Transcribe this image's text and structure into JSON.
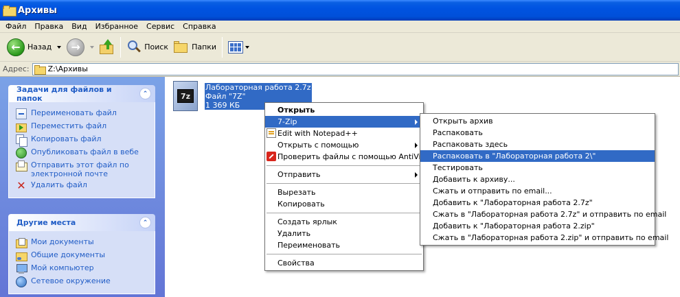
{
  "window": {
    "title": "Архивы"
  },
  "menubar": {
    "items": [
      "Файл",
      "Правка",
      "Вид",
      "Избранное",
      "Сервис",
      "Справка"
    ]
  },
  "toolbar": {
    "back_label": "Назад",
    "search_label": "Поиск",
    "folders_label": "Папки"
  },
  "address": {
    "label": "Адрес:",
    "value": "Z:\\Архивы"
  },
  "tasks_panel": {
    "title": "Задачи для файлов и папок",
    "items": [
      {
        "label": "Переименовать файл",
        "icon": "rename-icon"
      },
      {
        "label": "Переместить файл",
        "icon": "move-icon"
      },
      {
        "label": "Копировать файл",
        "icon": "copy-icon"
      },
      {
        "label": "Опубликовать файл в вебе",
        "icon": "web-publish-icon"
      },
      {
        "label": "Отправить этот файл по электронной почте",
        "icon": "email-icon"
      },
      {
        "label": "Удалить файл",
        "icon": "delete-icon"
      }
    ]
  },
  "places_panel": {
    "title": "Другие места",
    "items": [
      {
        "label": "Мои документы",
        "icon": "my-documents-icon"
      },
      {
        "label": "Общие документы",
        "icon": "shared-documents-icon"
      },
      {
        "label": "Мой компьютер",
        "icon": "my-computer-icon"
      },
      {
        "label": "Сетевое окружение",
        "icon": "network-icon"
      }
    ]
  },
  "file": {
    "name": "Лабораторная работа 2.7z",
    "type": "Файл \"7Z\"",
    "size": "1 369 КБ",
    "badge": "7z"
  },
  "context_menu": {
    "open": "Открыть",
    "sevenzip": "7-Zip",
    "notepad": "Edit with Notepad++",
    "open_with": "Открыть с помощью",
    "antivir": "Проверить файлы с помощью AntiVir",
    "send_to": "Отправить",
    "cut": "Вырезать",
    "copy": "Копировать",
    "shortcut": "Создать ярлык",
    "delete": "Удалить",
    "rename": "Переименовать",
    "properties": "Свойства"
  },
  "submenu_7zip": {
    "items": [
      "Открыть архив",
      "Распаковать",
      "Распаковать здесь",
      "Распаковать в \"Лабораторная работа 2\\\"",
      "Тестировать",
      "Добавить к архиву...",
      "Сжать и отправить по email...",
      "Добавить к \"Лабораторная работа 2.7z\"",
      "Сжать в \"Лабораторная работа 2.7z\" и отправить по email",
      "Добавить к \"Лабораторная работа 2.zip\"",
      "Сжать в \"Лабораторная работа 2.zip\" и отправить по email"
    ],
    "highlighted_index": 3
  },
  "colors": {
    "selection": "#316ac5",
    "titlebar": "#0053e1",
    "task_link": "#215dc6"
  }
}
